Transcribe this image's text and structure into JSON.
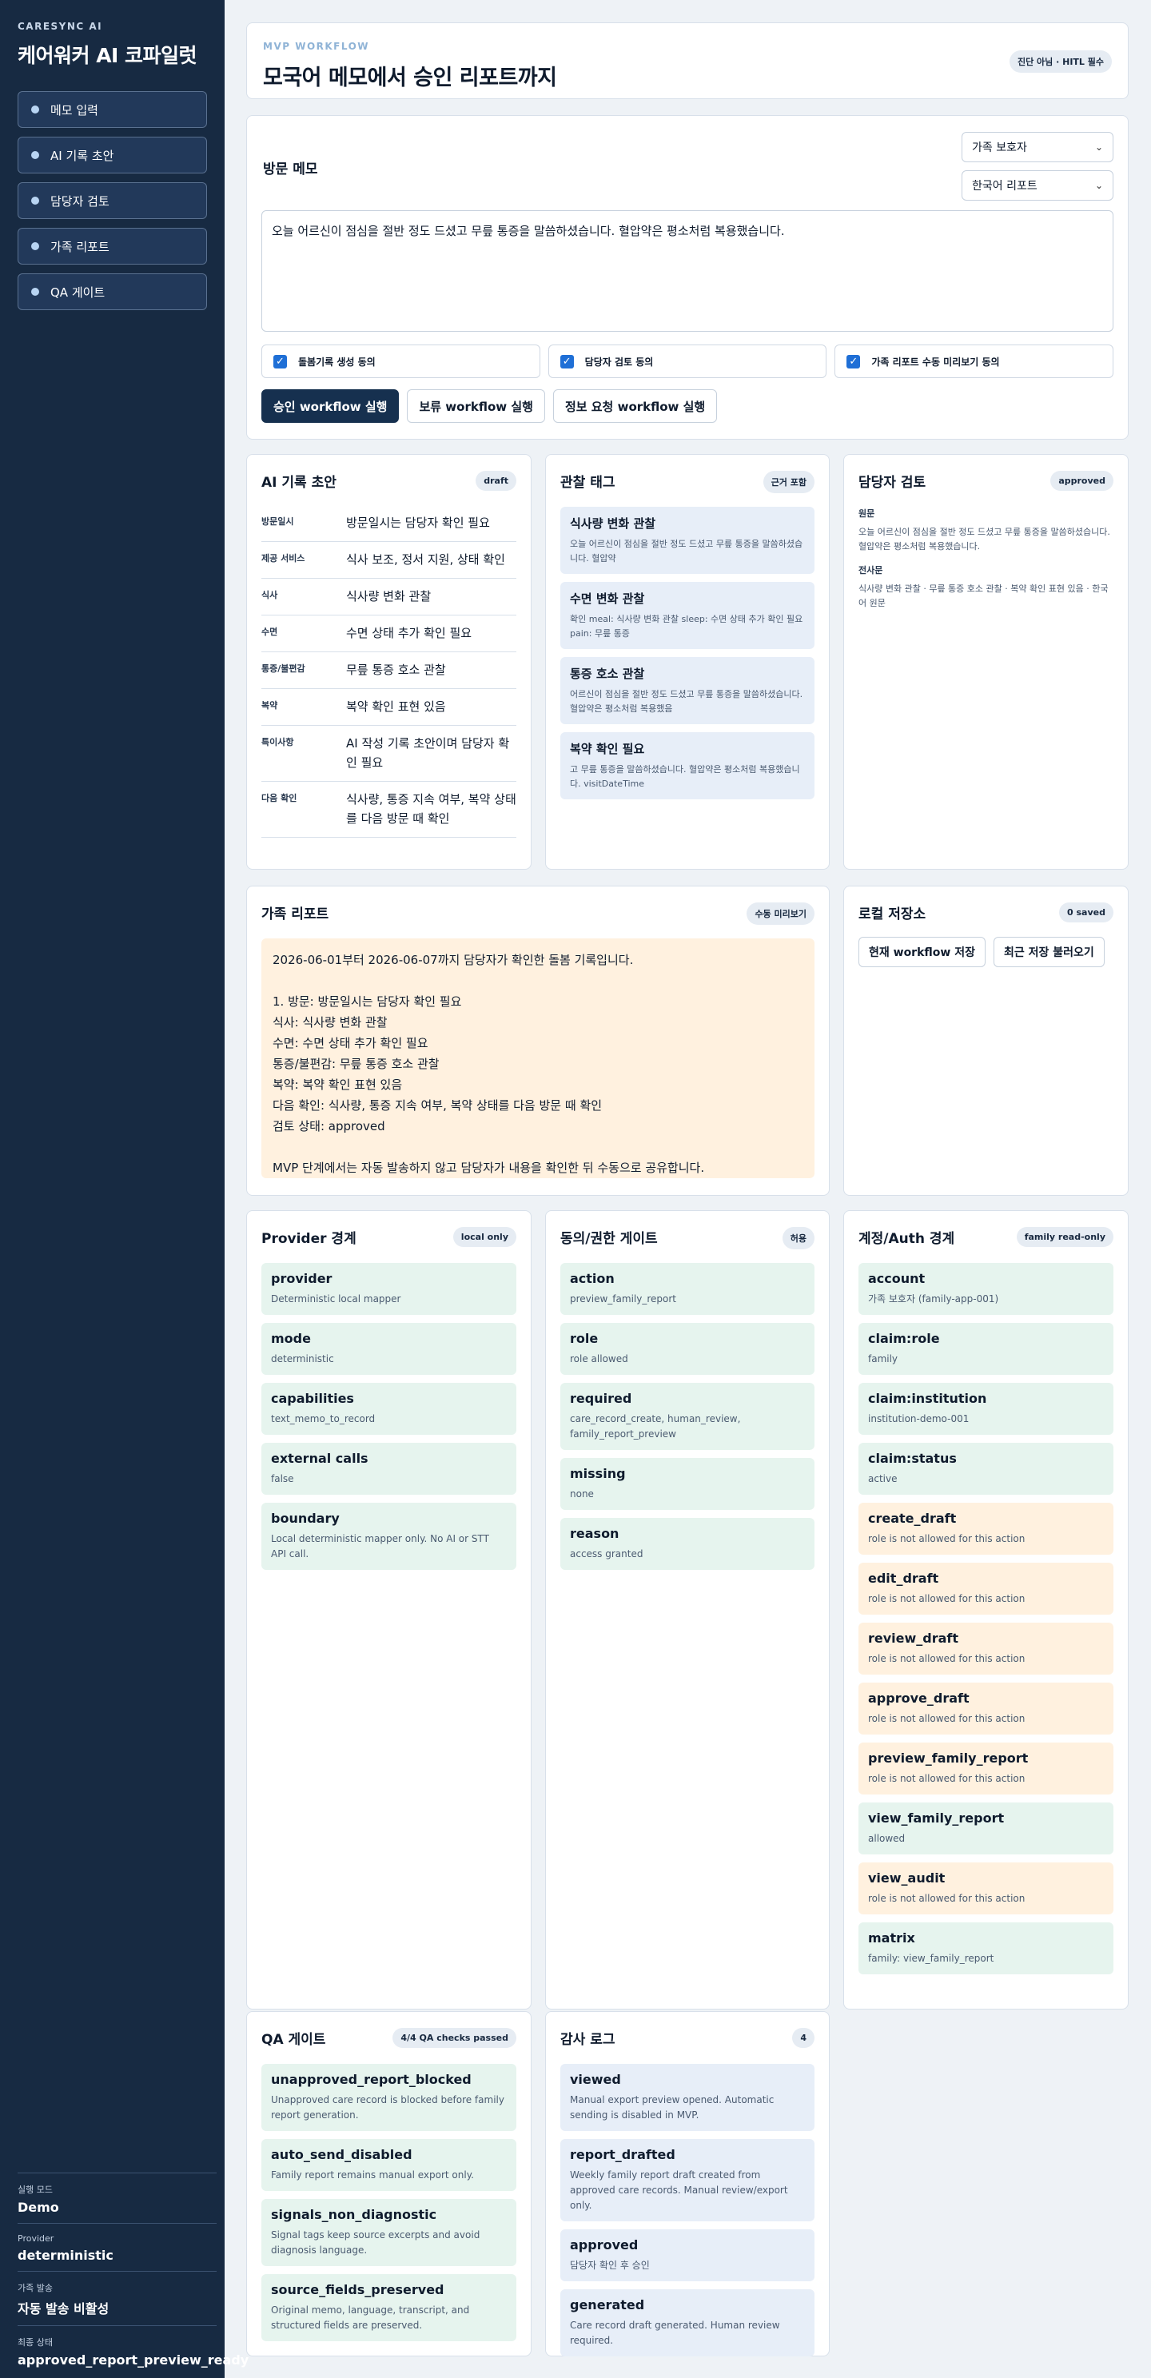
{
  "sidebar": {
    "brand_small": "CARESYNC AI",
    "brand_title": "케어워커 AI 코파일럿",
    "nav": [
      "메모 입력",
      "AI 기록 초안",
      "담당자 검토",
      "가족 리포트",
      "QA 게이트"
    ],
    "stats": [
      {
        "label": "실행 모드",
        "value": "Demo"
      },
      {
        "label": "Provider",
        "value": "deterministic"
      },
      {
        "label": "가족 발송",
        "value": "자동 발송 비활성"
      },
      {
        "label": "최종 상태",
        "value": "approved_report_preview_ready"
      }
    ]
  },
  "header": {
    "eyebrow": "MVP WORKFLOW",
    "title": "모국어 메모에서 승인 리포트까지",
    "badge": "진단 아님 · HITL 필수"
  },
  "memo": {
    "label": "방문 메모",
    "select_audience": "가족 보호자",
    "select_language": "한국어 리포트",
    "text": "오늘 어르신이 점심을 절반 정도 드셨고 무릎 통증을 말씀하셨습니다. 혈압약은 평소처럼 복용했습니다.",
    "checks": [
      "돌봄기록 생성 동의",
      "담당자 검토 동의",
      "가족 리포트 수동 미리보기 동의"
    ],
    "buttons": [
      "승인 workflow 실행",
      "보류 workflow 실행",
      "정보 요청 workflow 실행"
    ]
  },
  "ai_draft": {
    "title": "AI 기록 초안",
    "badge": "draft",
    "rows": [
      {
        "k": "방문일시",
        "v": "방문일시는 담당자 확인 필요"
      },
      {
        "k": "제공 서비스",
        "v": "식사 보조, 정서 지원, 상태 확인"
      },
      {
        "k": "식사",
        "v": "식사량 변화 관찰"
      },
      {
        "k": "수면",
        "v": "수면 상태 추가 확인 필요"
      },
      {
        "k": "통증/불편감",
        "v": "무릎 통증 호소 관찰"
      },
      {
        "k": "복약",
        "v": "복약 확인 표현 있음"
      },
      {
        "k": "특이사항",
        "v": "AI 작성 기록 초안이며 담당자 확인 필요"
      },
      {
        "k": "다음 확인",
        "v": "식사량, 통증 지속 여부, 복약 상태를 다음 방문 때 확인"
      }
    ]
  },
  "tags": {
    "title": "관찰 태그",
    "badge": "근거 포함",
    "items": [
      {
        "t": "식사량 변화 관찰",
        "d": "오늘 어르신이 점심을 절반 정도 드셨고 무릎 통증을 말씀하셨습니다. 혈압약"
      },
      {
        "t": "수면 변화 관찰",
        "d": "확인 meal: 식사량 변화 관찰 sleep: 수면 상태 추가 확인 필요 pain: 무릎 통증"
      },
      {
        "t": "통증 호소 관찰",
        "d": "어르신이 점심을 절반 정도 드셨고 무릎 통증을 말씀하셨습니다. 혈압약은 평소처럼 복용했음"
      },
      {
        "t": "복약 확인 필요",
        "d": "고 무릎 통증을 말씀하셨습니다. 혈압약은 평소처럼 복용했습니다. visitDateTime"
      }
    ]
  },
  "review": {
    "title": "담당자 검토",
    "badge": "approved",
    "original_label": "원문",
    "original_text": "오늘 어르신이 점심을 절반 정도 드셨고 무릎 통증을 말씀하셨습니다. 혈압약은 평소처럼 복용했습니다.",
    "summary_label": "전사문",
    "summary_text": "식사량 변화 관찰 · 무릎 통증 호소 관찰 · 복약 확인 표현 있음 · 한국어 원문"
  },
  "family": {
    "title": "가족 리포트",
    "badge": "수동 미리보기",
    "lines": [
      "2026-06-01부터 2026-06-07까지 담당자가 확인한 돌봄 기록입니다.",
      "",
      "1. 방문: 방문일시는 담당자 확인 필요",
      "식사: 식사량 변화 관찰",
      "수면: 수면 상태 추가 확인 필요",
      "통증/불편감: 무릎 통증 호소 관찰",
      "복약: 복약 확인 표현 있음",
      "다음 확인: 식사량, 통증 지속 여부, 복약 상태를 다음 방문 때 확인",
      "검토 상태: approved",
      "",
      "MVP 단계에서는 자동 발송하지 않고 담당자가 내용을 확인한 뒤 수동으로 공유합니다."
    ]
  },
  "local": {
    "title": "로컬 저장소",
    "badge": "0 saved",
    "buttons": [
      "현재 workflow 저장",
      "최근 저장 불러오기"
    ]
  },
  "provider": {
    "title": "Provider 경계",
    "badge": "local only",
    "items": [
      {
        "t": "provider",
        "d": "Deterministic local mapper"
      },
      {
        "t": "mode",
        "d": "deterministic"
      },
      {
        "t": "capabilities",
        "d": "text_memo_to_record"
      },
      {
        "t": "external calls",
        "d": "false"
      },
      {
        "t": "boundary",
        "d": "Local deterministic mapper only. No AI or STT API call."
      }
    ]
  },
  "consent": {
    "title": "동의/권한 게이트",
    "badge": "허용",
    "items": [
      {
        "t": "action",
        "d": "preview_family_report"
      },
      {
        "t": "role",
        "d": "role allowed"
      },
      {
        "t": "required",
        "d": "care_record_create, human_review, family_report_preview"
      },
      {
        "t": "missing",
        "d": "none"
      },
      {
        "t": "reason",
        "d": "access granted"
      }
    ]
  },
  "account": {
    "title": "계정/Auth 경계",
    "badge": "family read-only",
    "items": [
      {
        "t": "account",
        "d": "가족 보호자 (family-app-001)",
        "c": "green"
      },
      {
        "t": "claim:role",
        "d": "family",
        "c": "green"
      },
      {
        "t": "claim:institution",
        "d": "institution-demo-001",
        "c": "green"
      },
      {
        "t": "claim:status",
        "d": "active",
        "c": "green"
      },
      {
        "t": "create_draft",
        "d": "role is not allowed for this action",
        "c": "orange"
      },
      {
        "t": "edit_draft",
        "d": "role is not allowed for this action",
        "c": "orange"
      },
      {
        "t": "review_draft",
        "d": "role is not allowed for this action",
        "c": "orange"
      },
      {
        "t": "approve_draft",
        "d": "role is not allowed for this action",
        "c": "orange"
      },
      {
        "t": "preview_family_report",
        "d": "role is not allowed for this action",
        "c": "orange"
      },
      {
        "t": "view_family_report",
        "d": "allowed",
        "c": "green"
      },
      {
        "t": "view_audit",
        "d": "role is not allowed for this action",
        "c": "orange"
      },
      {
        "t": "matrix",
        "d": "family: view_family_report",
        "c": "green"
      }
    ]
  },
  "qa": {
    "title": "QA 게이트",
    "badge": "4/4 QA checks passed",
    "items": [
      {
        "t": "unapproved_report_blocked",
        "d": "Unapproved care record is blocked before family report generation."
      },
      {
        "t": "auto_send_disabled",
        "d": "Family report remains manual export only."
      },
      {
        "t": "signals_non_diagnostic",
        "d": "Signal tags keep source excerpts and avoid diagnosis language."
      },
      {
        "t": "source_fields_preserved",
        "d": "Original memo, language, transcript, and structured fields are preserved."
      }
    ]
  },
  "audit": {
    "title": "감사 로그",
    "badge": "4",
    "items": [
      {
        "t": "viewed",
        "d": "Manual export preview opened. Automatic sending is disabled in MVP."
      },
      {
        "t": "report_drafted",
        "d": "Weekly family report draft created from approved care records. Manual review/export only."
      },
      {
        "t": "approved",
        "d": "담당자 확인 후 승인"
      },
      {
        "t": "generated",
        "d": "Care record draft generated. Human review required."
      }
    ]
  }
}
